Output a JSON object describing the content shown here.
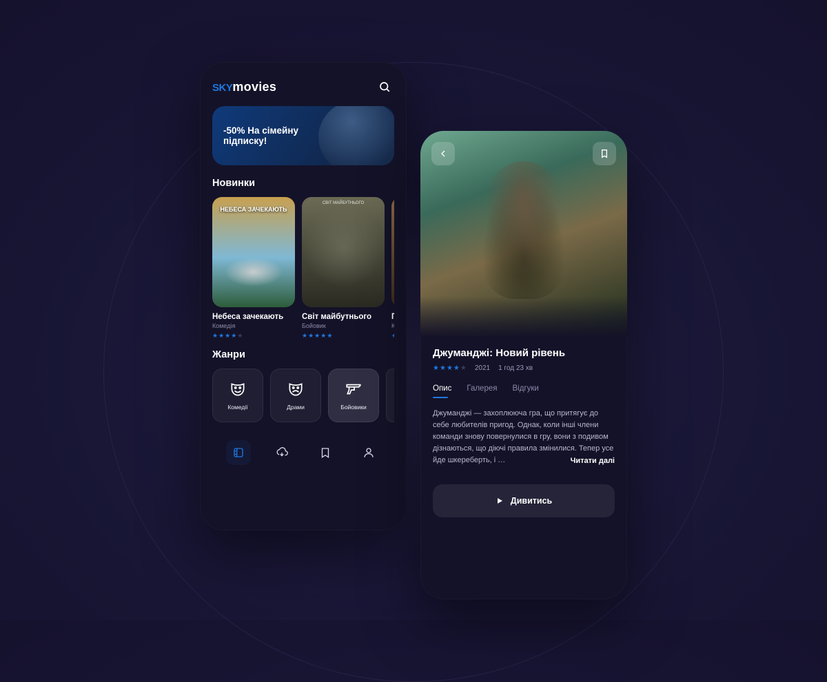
{
  "app": {
    "logo_brand": "sky",
    "logo_suffix": "movies"
  },
  "promo": {
    "text": "-50% На сімейну підписку!"
  },
  "sections": {
    "new_title": "Новинки",
    "genres_title": "Жанри"
  },
  "movies": [
    {
      "title": "Небеса зачекають",
      "genre": "Комедія",
      "rating": 4,
      "poster_top": "НЕБЕСА ЗАЧЕКАЮТЬ"
    },
    {
      "title": "Світ майбутнього",
      "genre": "Бойовик",
      "rating": 5,
      "poster_top": "СВІТ МАЙБУТНЬОГО"
    },
    {
      "title": "По",
      "genre": "Ко",
      "rating": 4,
      "poster_top": ""
    }
  ],
  "genres": [
    {
      "label": "Комедії",
      "icon": "comedy-mask-icon"
    },
    {
      "label": "Драми",
      "icon": "drama-mask-icon"
    },
    {
      "label": "Бойовики",
      "icon": "gun-icon"
    }
  ],
  "nav": {
    "items": [
      "browse-icon",
      "download-icon",
      "bookmark-icon",
      "profile-icon"
    ],
    "active_index": 0
  },
  "detail": {
    "title": "Джуманджі: Новий рівень",
    "rating": 4,
    "year": "2021",
    "duration": "1 год 23 хв",
    "tabs": [
      "Опис",
      "Галерея",
      "Відгуки"
    ],
    "active_tab": 0,
    "description": "Джуманджі — захоплююча гра, що притягує до себе любителів пригод. Однак, коли інші члени команди знову повернулися в гру, вони з подивом дізнаються, що діючі правила змінилися. Тепер усе йде шкереберть, і …",
    "read_more": "Читати далі",
    "watch_label": "Дивитись"
  },
  "colors": {
    "accent": "#1e78e0"
  }
}
